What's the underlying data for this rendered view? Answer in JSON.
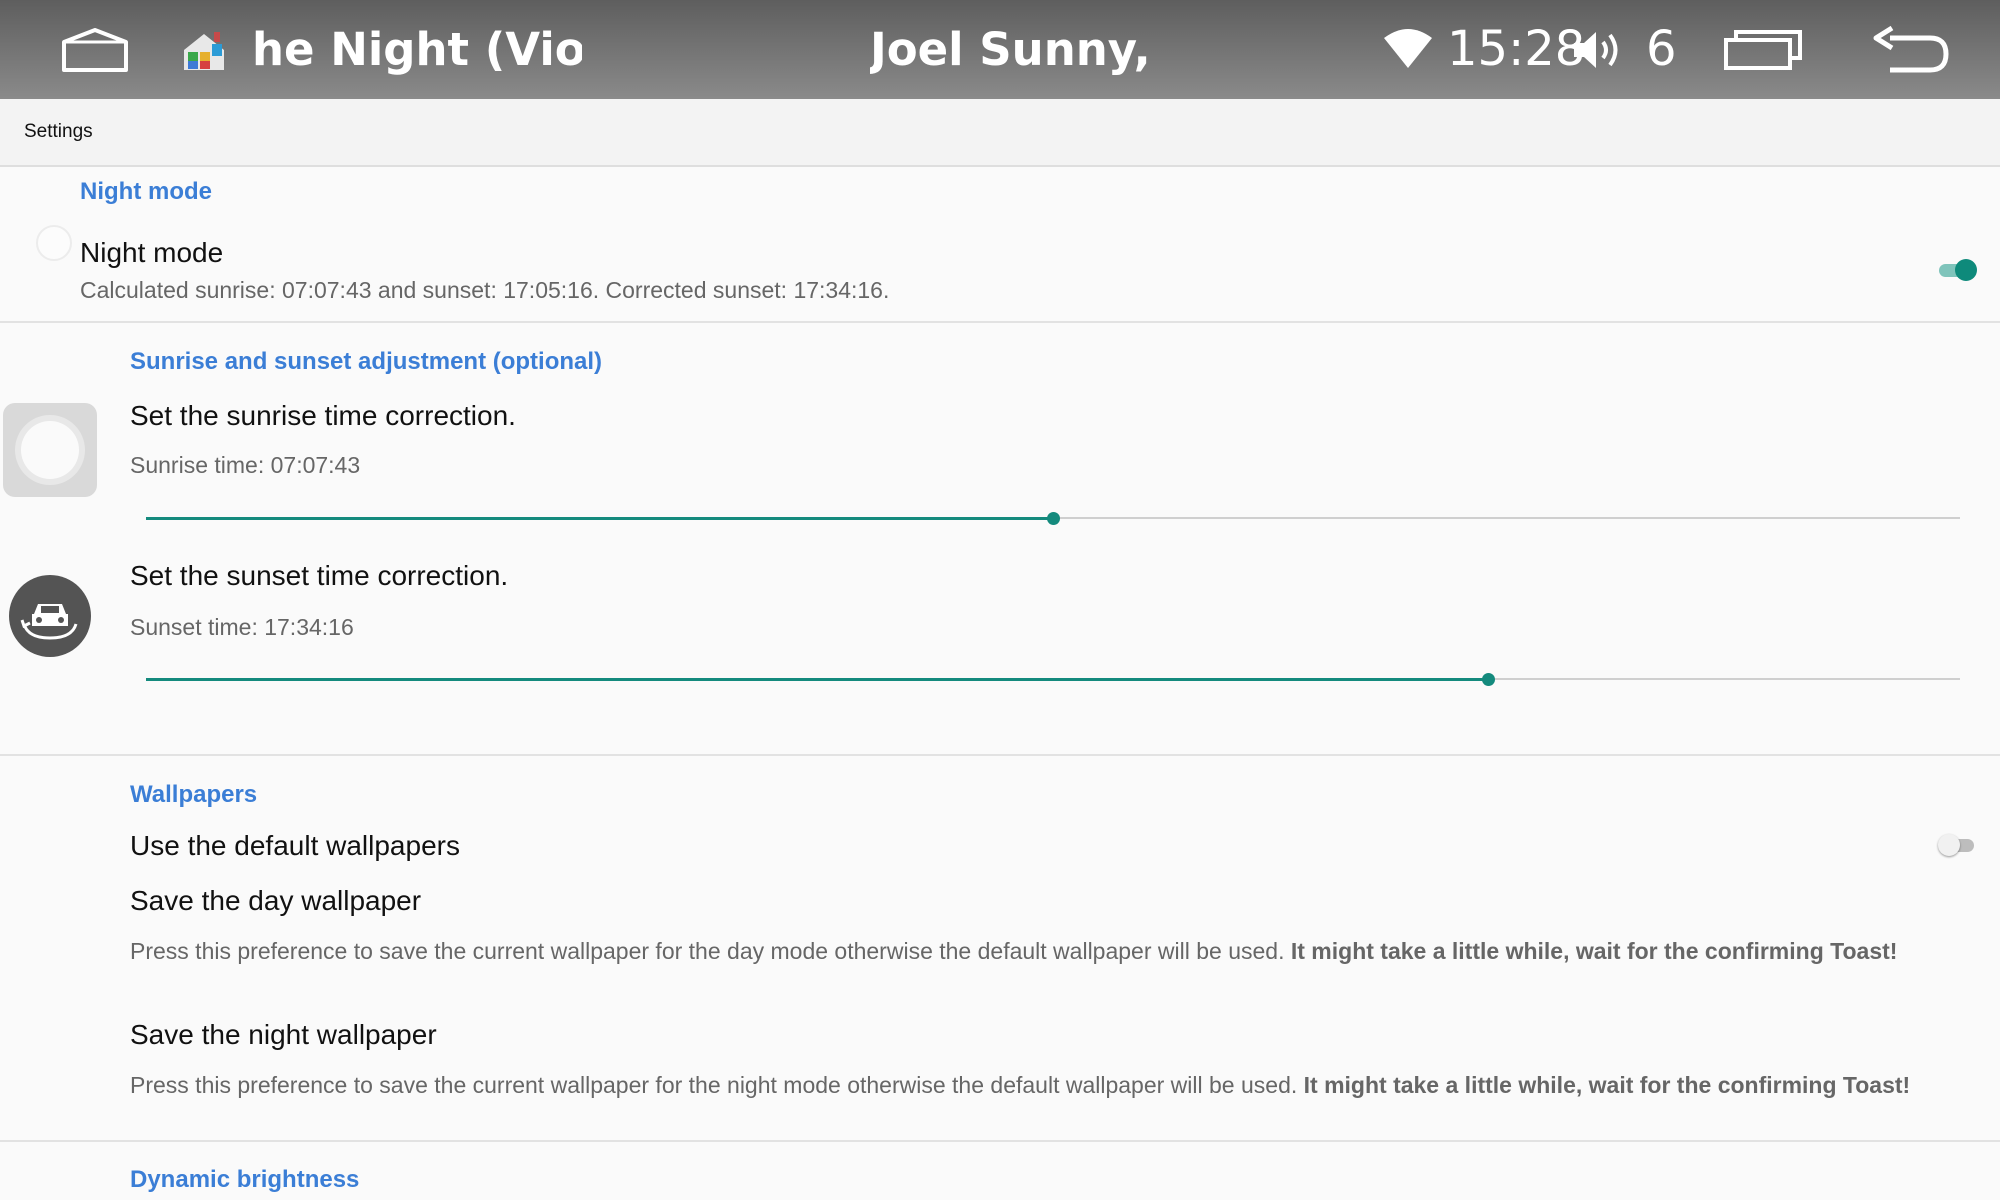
{
  "status_bar": {
    "media_title": "he Night (Violin)",
    "media_artist": "Joel Sunny, Dra",
    "clock": "15:28",
    "volume_level": "6",
    "icons": [
      "home-icon",
      "app-launcher-icon",
      "wifi-icon",
      "volume-icon",
      "recent-apps-icon",
      "back-icon"
    ]
  },
  "app_bar": {
    "title": "Settings"
  },
  "night_mode": {
    "category": "Night mode",
    "title": "Night mode",
    "summary": "Calculated sunrise: 07:07:43 and sunset: 17:05:16. Corrected sunset: 17:34:16.",
    "enabled": true
  },
  "adjustment": {
    "category": "Sunrise and sunset adjustment (optional)",
    "sunrise": {
      "title": "Set the sunrise time correction.",
      "summary": "Sunrise time: 07:07:43",
      "slider_fraction": 0.5
    },
    "sunset": {
      "title": "Set the sunset time correction.",
      "summary": "Sunset time: 17:34:16",
      "slider_fraction": 0.74
    }
  },
  "wallpapers": {
    "category": "Wallpapers",
    "default": {
      "title": "Use the default wallpapers",
      "enabled": false
    },
    "day": {
      "title": "Save the day wallpaper",
      "summary": "Press this preference to save the current wallpaper for the day mode otherwise the default wallpaper will be used.",
      "summary_bold": "It might take a little while, wait for the confirming Toast!"
    },
    "night": {
      "title": "Save the night wallpaper",
      "summary": "Press this preference to save the current wallpaper for the night mode otherwise the default wallpaper will be used.",
      "summary_bold": "It might take a little while, wait for the confirming Toast!"
    }
  },
  "dynamic_brightness": {
    "category": "Dynamic brightness"
  },
  "colors": {
    "accent": "#148a7d",
    "category_text": "#3b7ed6"
  }
}
